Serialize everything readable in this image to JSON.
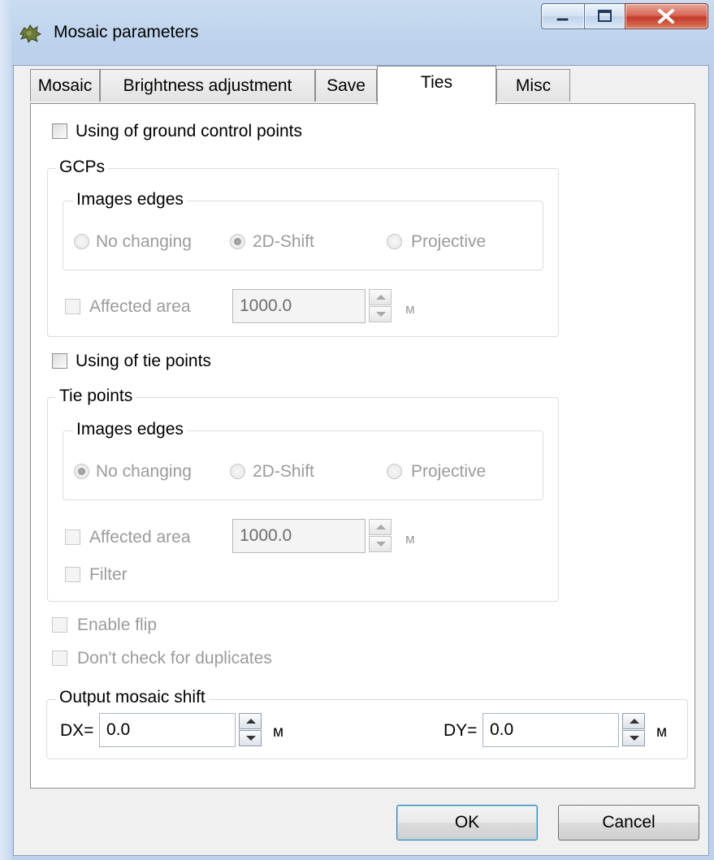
{
  "window": {
    "title": "Mosaic parameters"
  },
  "tabs": [
    {
      "label": "Mosaic",
      "active": false
    },
    {
      "label": "Brightness adjustment",
      "active": false
    },
    {
      "label": "Save",
      "active": false
    },
    {
      "label": "Ties",
      "active": true
    },
    {
      "label": "Misc",
      "active": false
    }
  ],
  "gcp": {
    "toggle_label": "Using of ground control points",
    "toggle_checked": false,
    "group_title": "GCPs",
    "edges_title": "Images edges",
    "radios": [
      "No changing",
      "2D-Shift",
      "Projective"
    ],
    "selected": "2D-Shift",
    "affected_label": "Affected area",
    "affected_value": "1000.0",
    "affected_unit": "м"
  },
  "tie": {
    "toggle_label": "Using of tie points",
    "toggle_checked": false,
    "group_title": "Tie points",
    "edges_title": "Images edges",
    "radios": [
      "No changing",
      "2D-Shift",
      "Projective"
    ],
    "selected": "No changing",
    "affected_label": "Affected area",
    "affected_value": "1000.0",
    "affected_unit": "м",
    "filter_label": "Filter"
  },
  "options": {
    "enable_flip": "Enable flip",
    "no_duplicates": "Don't check for duplicates"
  },
  "shift": {
    "group_title": "Output mosaic shift",
    "dx_label": "DX=",
    "dx_value": "0.0",
    "dx_unit": "м",
    "dy_label": "DY=",
    "dy_value": "0.0",
    "dy_unit": "м"
  },
  "buttons": {
    "ok": "OK",
    "cancel": "Cancel"
  },
  "colors": {
    "frame": "#bcd2ec",
    "close_button": "#c43a2a",
    "default_button_border": "#3c7fb1"
  }
}
